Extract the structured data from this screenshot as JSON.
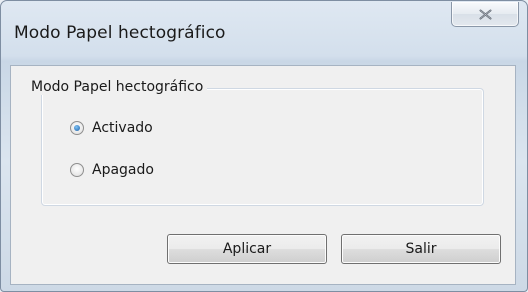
{
  "window": {
    "title": "Modo Papel hectográfico",
    "close_icon": "close-x-icon"
  },
  "group": {
    "legend": "Modo Papel hectográfico",
    "options": [
      {
        "label": "Activado",
        "checked": true
      },
      {
        "label": "Apagado",
        "checked": false
      }
    ]
  },
  "buttons": {
    "apply_label": "Aplicar",
    "exit_label": "Salir"
  },
  "colors": {
    "radio_selected": "#1b5fa8",
    "frame": "#c9d7e6"
  }
}
